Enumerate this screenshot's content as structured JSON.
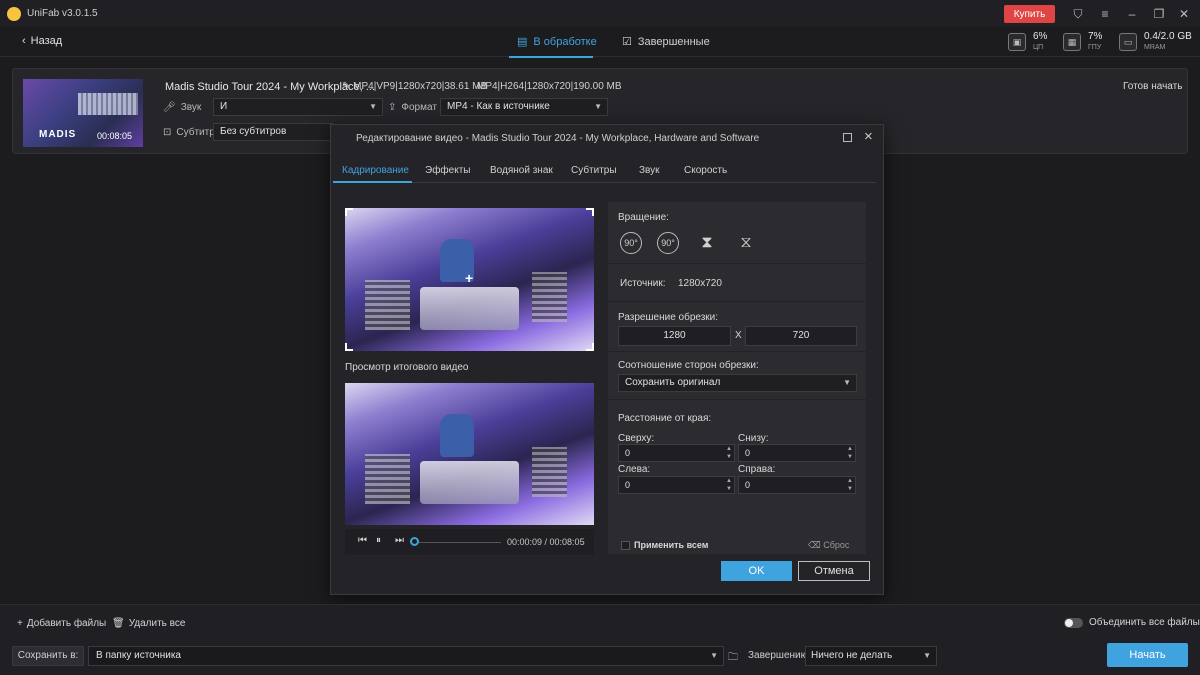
{
  "app": {
    "title": "UniFab v3.0.1.5",
    "buy_label": "Купить"
  },
  "nav": {
    "back_label": "Назад",
    "tab_processing": "В обработке",
    "tab_finished": "Завершенные",
    "stats": [
      {
        "value": "6%",
        "label": "ЦП",
        "icon": "cpu-icon"
      },
      {
        "value": "7%",
        "label": "ГПУ",
        "icon": "gpu-icon"
      },
      {
        "value": "0.4/2.0 GB",
        "label": "MRAM",
        "icon": "memory-icon"
      }
    ]
  },
  "file": {
    "title": "Madis Studio Tour 2024 - My Workplace, ...",
    "thumb_logo": "MADIS",
    "thumb_time": "00:08:05",
    "input_info": "MP4|VP9|1280x720|38.61 MB",
    "output_info": "MP4|H264|1280x720|190.00 MB",
    "status": "Готов начать",
    "audio_label": "Звук",
    "audio_value": "И",
    "format_label": "Формат",
    "format_value": "MP4 - Как в источнике",
    "subtitle_label": "Субтитр",
    "subtitle_value": "Без субтитров"
  },
  "dialog": {
    "title": "Редактирование видео - Madis Studio Tour 2024 - My Workplace, Hardware and Software",
    "tabs": [
      "Кадрирование",
      "Эффекты",
      "Водяной знак",
      "Субтитры",
      "Звук",
      "Скорость"
    ],
    "preview_label": "Просмотр итогового видео",
    "player_time": "00:00:09 / 00:08:05",
    "rotation_label": "Вращение:",
    "rot_left": "90°",
    "rot_right": "90°",
    "source_label": "Источник:",
    "source_value": "1280x720",
    "crop_res_label": "Разрешение обрезки:",
    "crop_width": "1280",
    "crop_x": "X",
    "crop_height": "720",
    "aspect_label": "Соотношение сторон обрезки:",
    "aspect_value": "Сохранить оригинал",
    "edge_label": "Расстояние от края:",
    "top_label": "Сверху:",
    "top_value": "0",
    "bottom_label": "Снизу:",
    "bottom_value": "0",
    "left_label": "Слева:",
    "left_value": "0",
    "right_label": "Справа:",
    "right_value": "0",
    "apply_all": "Применить всем",
    "reset": "Сброс",
    "ok": "OK",
    "cancel": "Отмена"
  },
  "bottom": {
    "add_files": "Добавить файлы",
    "remove_all": "Удалить все",
    "merge_label": "Объединить все файлы",
    "save_to_label": "Сохранить в:",
    "save_to_value": "В папку источника",
    "finish_label": "Завершению",
    "finish_value": "Ничего не делать",
    "start": "Начать"
  },
  "colors": {
    "accent": "#3fa3e0",
    "buy": "#e04545",
    "bg": "#1c1c1f"
  }
}
